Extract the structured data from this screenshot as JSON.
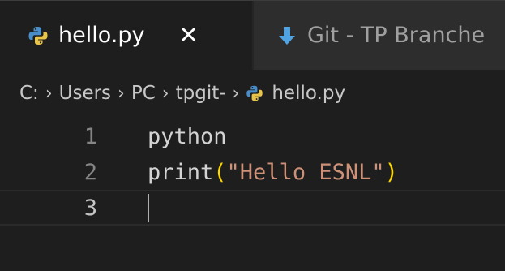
{
  "tabs": {
    "active": {
      "label": "hello.py",
      "close_glyph": "✕",
      "icon": "python-icon"
    },
    "inactive": {
      "label": "Git - TP Branche",
      "icon": "download-icon"
    }
  },
  "breadcrumb": {
    "items": [
      "C:",
      "Users",
      "PC",
      "tpgit-",
      "hello.py"
    ],
    "separator": "›"
  },
  "editor": {
    "lines": [
      {
        "number": "1",
        "text": "python"
      },
      {
        "number": "2",
        "fn": "print",
        "open": "(",
        "string": "\"Hello ESNL\"",
        "close": ")"
      },
      {
        "number": "3",
        "text": ""
      }
    ]
  },
  "colors": {
    "background": "#1e1e1e",
    "tabbar": "#252526",
    "string": "#ce9178",
    "bracket": "#ffd700",
    "python_blue": "#4a8ec9",
    "python_yellow": "#e8c548"
  }
}
